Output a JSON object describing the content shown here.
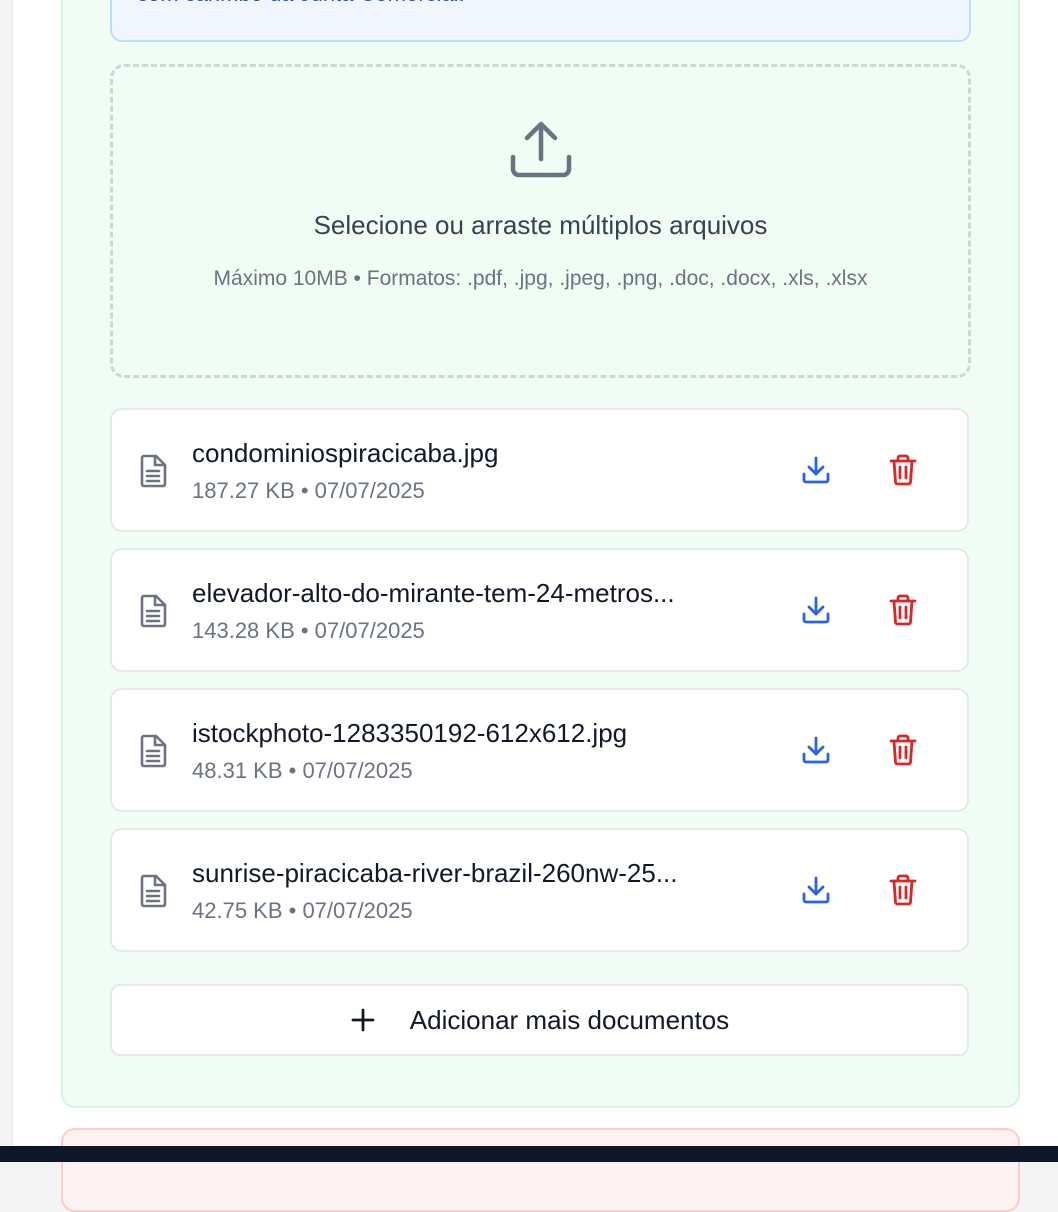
{
  "info": {
    "text": "com carimbo da Junta Comercial."
  },
  "dropzone": {
    "icon": "upload-icon",
    "title": "Selecione ou arraste múltiplos arquivos",
    "hint": "Máximo 10MB • Formatos: .pdf, .jpg, .jpeg, .png, .doc, .docx, .xls, .xlsx"
  },
  "files": [
    {
      "name": "condominiospiracicaba.jpg",
      "meta": "187.27 KB • 07/07/2025"
    },
    {
      "name": "elevador-alto-do-mirante-tem-24-metros...",
      "meta": "143.28 KB • 07/07/2025"
    },
    {
      "name": "istockphoto-1283350192-612x612.jpg",
      "meta": "48.31 KB • 07/07/2025"
    },
    {
      "name": "sunrise-piracicaba-river-brazil-260nw-25...",
      "meta": "42.75 KB • 07/07/2025"
    }
  ],
  "actions": {
    "add_more_label": "Adicionar mais documentos"
  },
  "colors": {
    "section_bg": "#f0fdf4",
    "info_text": "#1d4ed8",
    "download": "#2563eb",
    "delete": "#dc2626"
  }
}
